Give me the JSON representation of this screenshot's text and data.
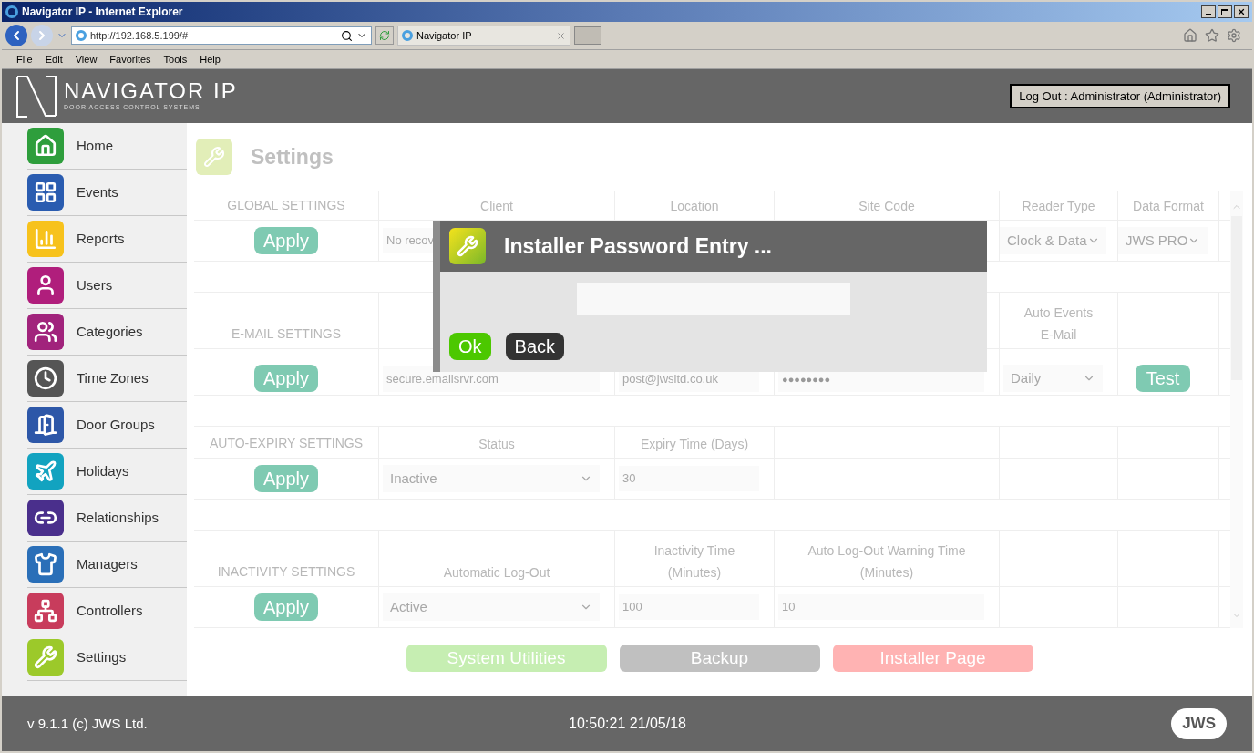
{
  "window": {
    "title": "Navigator IP - Internet Explorer"
  },
  "browser": {
    "address": "http://192.168.5.199/#",
    "tab": "Navigator IP",
    "menu": [
      "File",
      "Edit",
      "View",
      "Favorites",
      "Tools",
      "Help"
    ]
  },
  "header": {
    "logo_title": "NAVIGATOR IP",
    "logo_subtitle": "DOOR ACCESS CONTROL SYSTEMS",
    "logout": "Log Out : Administrator (Administrator)"
  },
  "sidebar": {
    "items": [
      {
        "label": "Home",
        "color": "#2e9e3c"
      },
      {
        "label": "Events",
        "color": "#2a5cb0"
      },
      {
        "label": "Reports",
        "color": "#f7c21c"
      },
      {
        "label": "Users",
        "color": "#b01e7c"
      },
      {
        "label": "Categories",
        "color": "#a1237c"
      },
      {
        "label": "Time Zones",
        "color": "#555555"
      },
      {
        "label": "Door Groups",
        "color": "#2d57a8"
      },
      {
        "label": "Holidays",
        "color": "#12a3c0"
      },
      {
        "label": "Relationships",
        "color": "#4a2f8c"
      },
      {
        "label": "Managers",
        "color": "#2a6fb8"
      },
      {
        "label": "Controllers",
        "color": "#c83c5c"
      },
      {
        "label": "Settings",
        "color": "#9cc92a"
      }
    ]
  },
  "page": {
    "title": "Settings"
  },
  "sections": [
    {
      "title": "GLOBAL SETTINGS",
      "apply": "Apply",
      "fields": [
        {
          "kind": "text",
          "header": "Client",
          "value": "No recov"
        },
        {
          "kind": "empty",
          "header": "Location"
        },
        {
          "kind": "empty",
          "header": "Site Code"
        },
        {
          "kind": "select",
          "header": "Reader Type",
          "value": "Clock & Data"
        },
        {
          "kind": "select",
          "header": "Data Format",
          "value": "JWS PRO"
        }
      ]
    },
    {
      "title": "E-MAIL SETTINGS",
      "apply": "Apply",
      "fields": [
        {
          "kind": "text",
          "value": "secure.emailsrvr.com"
        },
        {
          "kind": "text",
          "value": "post@jwsltd.co.uk"
        },
        {
          "kind": "password",
          "value": "●●●●●●●●"
        },
        {
          "kind": "select",
          "header": "Auto Events E-Mail",
          "value": "Daily"
        },
        {
          "kind": "button",
          "value": "Test"
        }
      ]
    },
    {
      "title": "AUTO-EXPIRY SETTINGS",
      "apply": "Apply",
      "fields": [
        {
          "kind": "select",
          "header": "Status",
          "value": "Inactive"
        },
        {
          "kind": "text",
          "header": "Expiry Time (Days)",
          "value": "30"
        },
        {
          "kind": "empty"
        },
        {
          "kind": "empty"
        },
        {
          "kind": "empty"
        }
      ]
    },
    {
      "title": "INACTIVITY SETTINGS",
      "apply": "Apply",
      "fields": [
        {
          "kind": "select",
          "header": "Automatic Log-Out",
          "value": "Active"
        },
        {
          "kind": "text",
          "header": "Inactivity Time (Minutes)",
          "value": "100"
        },
        {
          "kind": "text",
          "header": "Auto Log-Out Warning Time (Minutes)",
          "value": "10"
        },
        {
          "kind": "empty"
        },
        {
          "kind": "empty"
        }
      ]
    }
  ],
  "bottom_buttons": [
    {
      "label": "System Utilities",
      "color": "#c6eeb2"
    },
    {
      "label": "Backup",
      "color": "#c0c0c0"
    },
    {
      "label": "Installer Page",
      "color": "#ffb3b3"
    }
  ],
  "dialog": {
    "title": "Installer Password Entry ...",
    "ok": "Ok",
    "back": "Back"
  },
  "footer": {
    "version": "v 9.1.1 (c) JWS Ltd.",
    "datetime": "10:50:21 21/05/18",
    "logo": "JWS"
  }
}
